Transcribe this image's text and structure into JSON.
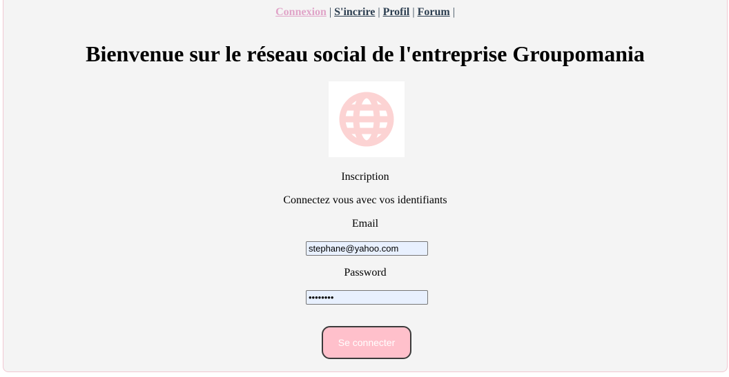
{
  "nav": {
    "items": [
      {
        "label": "Connexion",
        "active": true
      },
      {
        "label": "S'incrire",
        "active": false
      },
      {
        "label": "Profil",
        "active": false
      },
      {
        "label": "Forum",
        "active": false
      }
    ],
    "separator": "|"
  },
  "page": {
    "title": "Bienvenue sur le réseau social de l'entreprise Groupomania"
  },
  "logo": {
    "icon": "globe-icon",
    "color": "#fcd3d3"
  },
  "form": {
    "heading": "Inscription",
    "subtitle": "Connectez vous avec vos identifiants",
    "email_label": "Email",
    "email_value": "stephane@yahoo.com",
    "password_label": "Password",
    "password_value": "password",
    "submit_label": "Se connecter"
  },
  "colors": {
    "accent_pink": "#ffc0cb",
    "active_link": "#e0a4c8",
    "background": "#f4f4f4"
  }
}
